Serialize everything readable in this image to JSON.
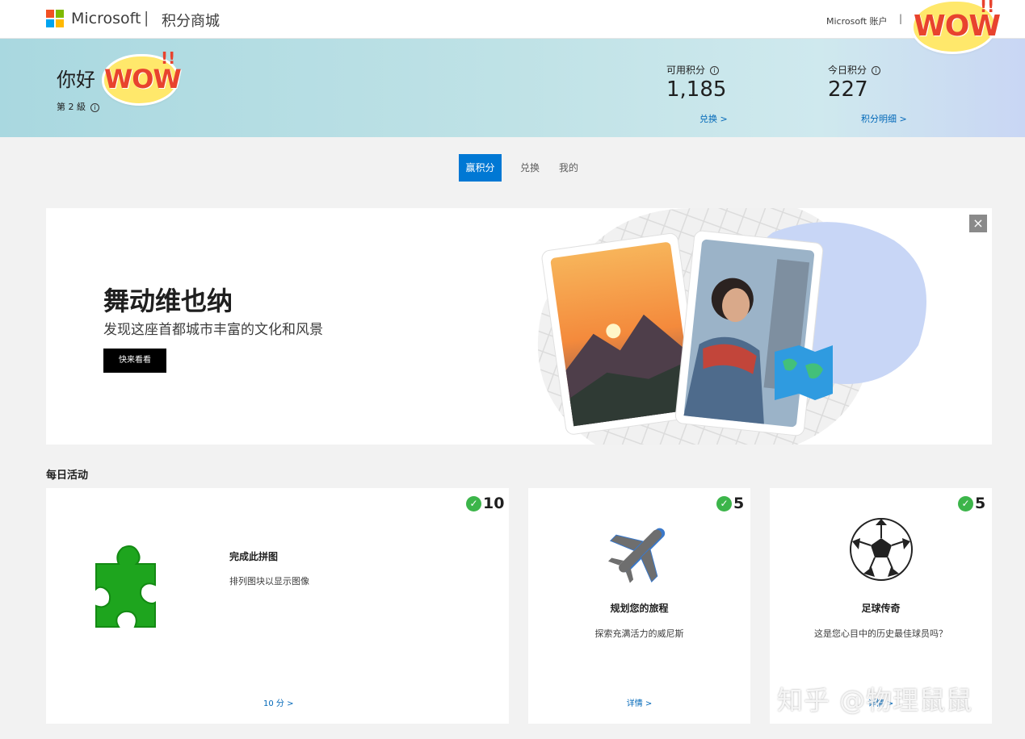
{
  "header": {
    "brand": "Microsoft",
    "separator": "|",
    "site_name": "积分商城",
    "account_link": "Microsoft 账户",
    "account_separator": "|"
  },
  "stickers": {
    "wow_text": "WOW",
    "wow_bang": "!!"
  },
  "banner": {
    "greeting": "你好",
    "level": "第 2 級",
    "available": {
      "label": "可用积分",
      "value": "1,185",
      "link": "兑换 >"
    },
    "today": {
      "label": "今日积分",
      "value": "227",
      "link": "积分明细 >"
    },
    "info_glyph": "i"
  },
  "tabs": [
    {
      "label": "赢积分",
      "active": true
    },
    {
      "label": "兑换",
      "active": false
    },
    {
      "label": "我的",
      "active": false
    }
  ],
  "hero": {
    "title": "舞动维也纳",
    "subtitle": "发现这座首都城市丰富的文化和风景",
    "button": "快来看看",
    "close": "×"
  },
  "daily": {
    "title": "每日活动",
    "cards": [
      {
        "points": "10",
        "title": "完成此拼图",
        "desc": "排列图块以显示图像",
        "link": "10 分 >",
        "icon": "puzzle-icon"
      },
      {
        "points": "5",
        "title": "规划您的旅程",
        "desc": "探索充满活力的威尼斯",
        "link": "详情 >",
        "icon": "airplane-icon"
      },
      {
        "points": "5",
        "title": "足球传奇",
        "desc": "这是您心目中的历史最佳球员吗？",
        "link": "详情 >",
        "icon": "soccer-ball-icon"
      }
    ],
    "check_glyph": "✓"
  },
  "watermark": "知乎 @物理鼠鼠",
  "colors": {
    "accent": "#0078d4",
    "link": "#0067b8",
    "check": "#3cb54a",
    "puzzle": "#1ea51e"
  }
}
